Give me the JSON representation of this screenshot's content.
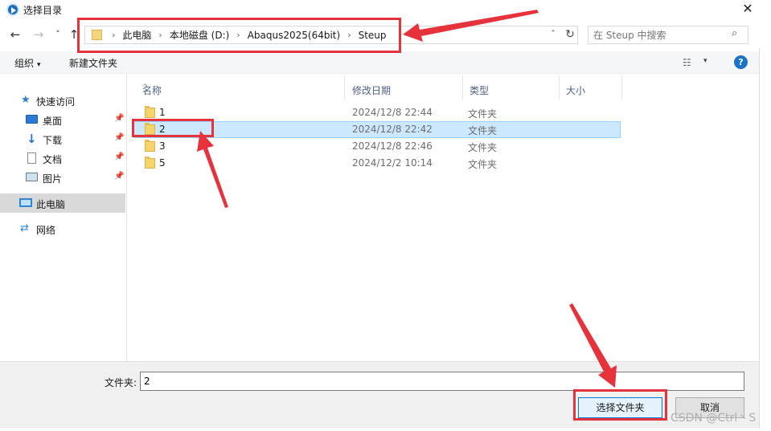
{
  "window": {
    "title": "选择目录",
    "close_glyph": "✕"
  },
  "nav": {
    "back_glyph": "←",
    "forward_glyph": "→",
    "recent_glyph": "˅",
    "up_glyph": "↑",
    "breadcrumb": [
      "此电脑",
      "本地磁盘 (D:)",
      "Abaqus2025(64bit)",
      "Steup"
    ],
    "sep_glyph": "›",
    "addr_dropdown_glyph": "˅",
    "refresh_glyph": "↻",
    "search_placeholder": "在 Steup 中搜索",
    "search_glyph": "⌕"
  },
  "toolbar": {
    "organize_label": "组织",
    "new_folder_label": "新建文件夹",
    "caret": "▾",
    "view_glyph": "☷",
    "help_glyph": "?"
  },
  "sidebar": {
    "items": [
      {
        "label": "快速访问",
        "icon": "star-icon",
        "glyph": "★"
      },
      {
        "label": "桌面",
        "icon": "desktop-icon",
        "pinned": true
      },
      {
        "label": "下载",
        "icon": "download-icon",
        "glyph": "↓",
        "pinned": true
      },
      {
        "label": "文档",
        "icon": "document-icon",
        "pinned": true
      },
      {
        "label": "图片",
        "icon": "picture-icon",
        "pinned": true
      },
      {
        "label": "此电脑",
        "icon": "computer-icon",
        "selected": true
      },
      {
        "label": "网络",
        "icon": "network-icon",
        "glyph": "⇄"
      }
    ],
    "pin_glyph": "📌"
  },
  "filelist": {
    "columns": [
      "名称",
      "修改日期",
      "类型",
      "大小"
    ],
    "sort_glyph": "^",
    "rows": [
      {
        "name": "1",
        "date": "2024/12/8 22:44",
        "type": "文件夹"
      },
      {
        "name": "2",
        "date": "2024/12/8 22:42",
        "type": "文件夹",
        "selected": true
      },
      {
        "name": "3",
        "date": "2024/12/8 22:46",
        "type": "文件夹"
      },
      {
        "name": "5",
        "date": "2024/12/2 10:14",
        "type": "文件夹"
      }
    ]
  },
  "footer": {
    "folder_label": "文件夹:",
    "folder_value": "2",
    "select_button": "选择文件夹",
    "cancel_button": "取消"
  },
  "watermark": "CSDN @Ctrl丶S",
  "colors": {
    "accent": "#0078d7",
    "annotation_red": "#e5323b",
    "selection": "#cce8ff"
  }
}
